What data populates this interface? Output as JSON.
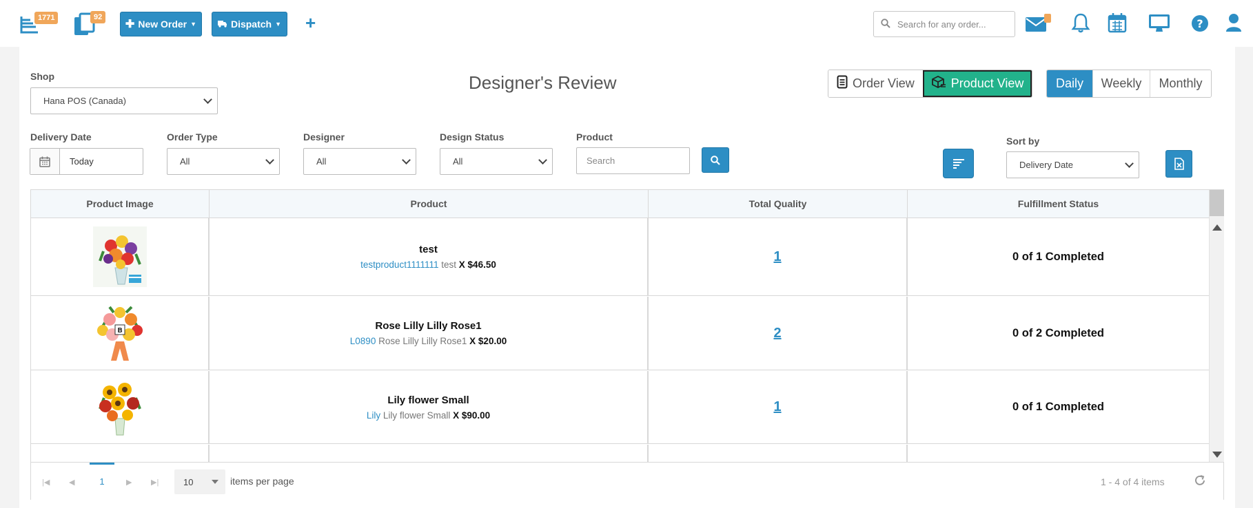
{
  "topbar": {
    "orders_badge": "1771",
    "tasks_badge": "92",
    "new_order_label": "New Order",
    "dispatch_label": "Dispatch",
    "search_placeholder": "Search for any order..."
  },
  "filters": {
    "shop_label": "Shop",
    "shop_value": "Hana POS (Canada)",
    "delivery_date_label": "Delivery Date",
    "delivery_date_value": "Today",
    "order_type_label": "Order Type",
    "order_type_value": "All",
    "designer_label": "Designer",
    "designer_value": "All",
    "design_status_label": "Design Status",
    "design_status_value": "All",
    "product_label": "Product",
    "product_placeholder": "Search",
    "sort_by_label": "Sort by",
    "sort_by_value": "Delivery Date"
  },
  "page_title": "Designer's Review",
  "view_toggle": {
    "order_view": "Order View",
    "product_view": "Product View",
    "active": "product_view"
  },
  "period_toggle": {
    "daily": "Daily",
    "weekly": "Weekly",
    "monthly": "Monthly",
    "active": "daily"
  },
  "table": {
    "headers": [
      "Product Image",
      "Product",
      "Total Quality",
      "Fulfillment Status"
    ],
    "rows": [
      {
        "name": "test",
        "code": "testproduct1111111",
        "desc": "test",
        "price": "X $46.50",
        "qty": "1",
        "status": "0 of 1 Completed",
        "image": "mixed-bouquet-with-gift"
      },
      {
        "name": "Rose Lilly Lilly Rose1",
        "code": "L0890",
        "desc": "Rose Lilly Lilly Rose1",
        "price": "X $20.00",
        "qty": "2",
        "status": "0 of 2 Completed",
        "image": "bouquet-with-orange-ribbon"
      },
      {
        "name": "Lily flower Small",
        "code": "Lily",
        "desc": "Lily flower Small",
        "price": "X $90.00",
        "qty": "1",
        "status": "0 of 1 Completed",
        "image": "sunflower-bouquet"
      }
    ]
  },
  "pager": {
    "current_page": "1",
    "page_size": "10",
    "items_per_page_label": "items per page",
    "info": "1 - 4 of 4 items"
  },
  "colors": {
    "primary": "#2d8ec4",
    "accent_green": "#22b28b",
    "badge": "#f0a65a"
  }
}
